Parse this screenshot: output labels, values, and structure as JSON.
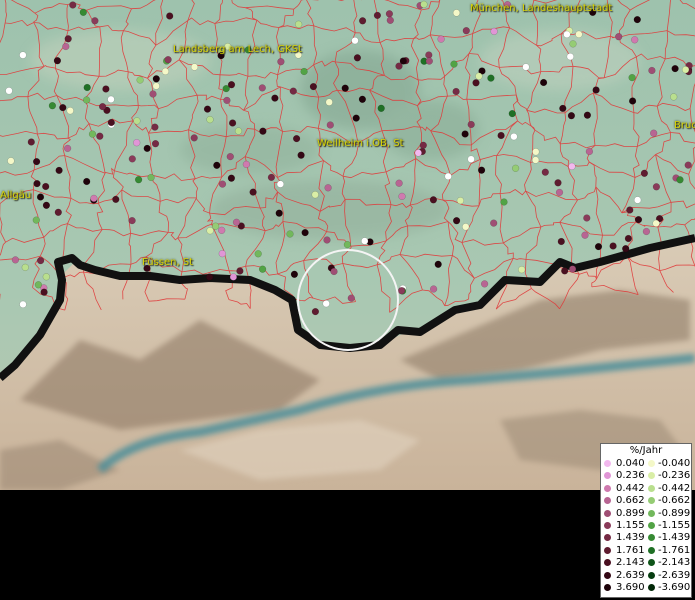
{
  "places": [
    {
      "name": "München, Landeshauptstadt"
    },
    {
      "name": "Landsberg am Lech, GKSt"
    },
    {
      "name": "Weilheim i.OB, St"
    },
    {
      "name": "Bruc"
    },
    {
      "name": "Allgäu"
    },
    {
      "name": "Füssen, St"
    }
  ],
  "legend": {
    "title": "%/Jahr",
    "positive": [
      {
        "label": "0.040",
        "color": "#f2b8ee"
      },
      {
        "label": "0.236",
        "color": "#e095d6"
      },
      {
        "label": "0.442",
        "color": "#cf7aaf"
      },
      {
        "label": "0.662",
        "color": "#b86593"
      },
      {
        "label": "0.899",
        "color": "#9f4e74"
      },
      {
        "label": "1.155",
        "color": "#8a3b5a"
      },
      {
        "label": "1.439",
        "color": "#752a44"
      },
      {
        "label": "1.761",
        "color": "#5f1c30"
      },
      {
        "label": "2.143",
        "color": "#4a1020"
      },
      {
        "label": "2.639",
        "color": "#340815"
      },
      {
        "label": "3.690",
        "color": "#1e030a"
      }
    ],
    "negative": [
      {
        "label": "-0.040",
        "color": "#f4f8c8"
      },
      {
        "label": "-0.236",
        "color": "#d9eea6"
      },
      {
        "label": "-0.442",
        "color": "#b9df8e"
      },
      {
        "label": "-0.662",
        "color": "#95cc74"
      },
      {
        "label": "-0.899",
        "color": "#72b85c"
      },
      {
        "label": "-1.155",
        "color": "#52a345"
      },
      {
        "label": "-1.439",
        "color": "#368a33"
      },
      {
        "label": "-1.761",
        "color": "#1f7025"
      },
      {
        "label": "-2.143",
        "color": "#0f5419"
      },
      {
        "label": "-2.639",
        "color": "#063d10"
      },
      {
        "label": "-3.690",
        "color": "#022808"
      }
    ]
  }
}
